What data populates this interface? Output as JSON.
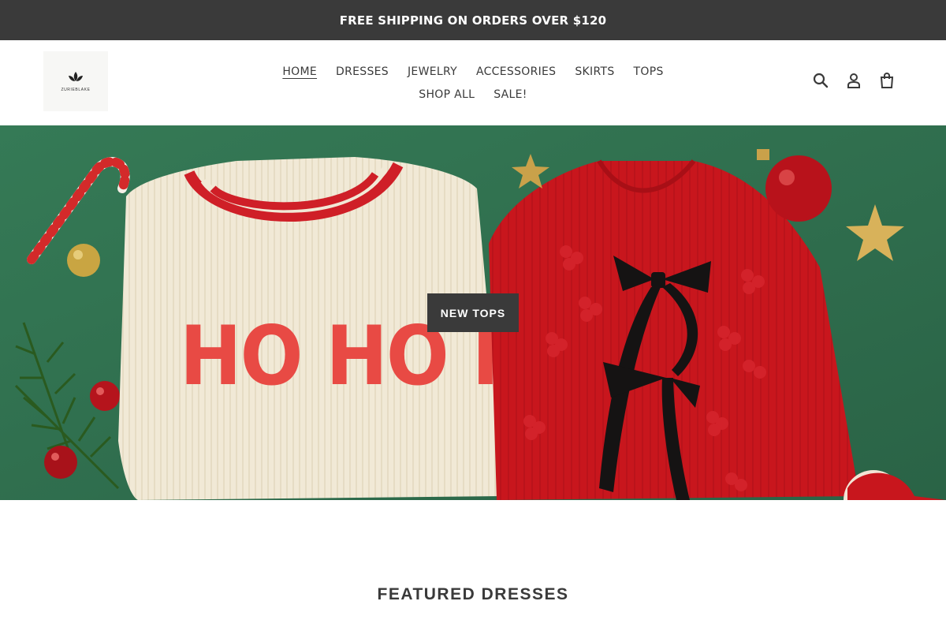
{
  "announcement": {
    "text": "FREE SHIPPING ON ORDERS OVER $120"
  },
  "header": {
    "logo_text": "ZURIEBLAKE",
    "nav_row1": [
      {
        "label": "HOME",
        "active": true
      },
      {
        "label": "DRESSES"
      },
      {
        "label": "JEWELRY"
      },
      {
        "label": "ACCESSORIES"
      },
      {
        "label": "SKIRTS"
      },
      {
        "label": "TOPS"
      }
    ],
    "nav_row2": [
      {
        "label": "SHOP ALL"
      },
      {
        "label": "SALE!"
      }
    ],
    "icons": [
      "search-icon",
      "account-icon",
      "cart-icon"
    ]
  },
  "hero": {
    "button_label": "NEW TOPS",
    "sweater_text": "HO HO HO",
    "colors": {
      "background": "#2f6b4c",
      "cream": "#f1e9d6",
      "red": "#c8161d"
    }
  },
  "featured": {
    "title": "FEATURED DRESSES"
  }
}
